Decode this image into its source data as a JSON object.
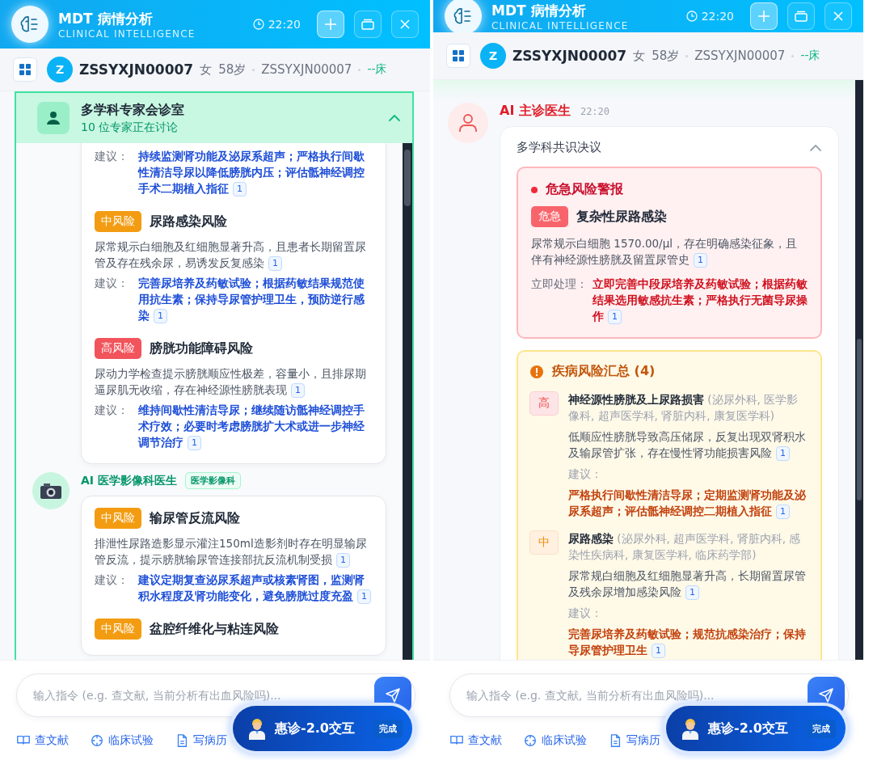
{
  "panels": [
    {
      "header": {
        "title": "MDT 病情分析",
        "subtitle": "CLINICAL INTELLIGENCE",
        "time": "22:20"
      },
      "patient": {
        "avatar": "Z",
        "id": "ZSSYXJN00007",
        "gender": "女",
        "age": "58岁",
        "record": "ZSSYXJN00007",
        "bed": "--床"
      },
      "kind": "room",
      "room": {
        "title": "多学科专家会诊室",
        "subtitle": "10 位专家正在讨论",
        "expanded": true
      },
      "messages": [
        {
          "items": [
            {
              "advice_label": "建议：",
              "advice": "持续监测肾功能及泌尿系超声；严格执行间歇性清洁导尿以降低膀胱内压；评估骶神经调控手术二期植入指征",
              "advice_ref": "1"
            },
            {
              "level": "中风险",
              "kind": "medium",
              "title": "尿路感染风险",
              "desc": "尿常规示白细胞及红细胞显著升高，且患者长期留置尿管及存在残余尿，易诱发反复感染",
              "desc_ref": "1",
              "advice_label": "建议：",
              "advice": "完善尿培养及药敏试验；根据药敏结果规范使用抗生素；保持导尿管护理卫生，预防逆行感染",
              "advice_ref": "1"
            },
            {
              "level": "高风险",
              "kind": "high",
              "title": "膀胱功能障碍风险",
              "desc": "尿动力学检查提示膀胱顺应性极差，容量小，且排尿期逼尿肌无收缩，存在神经源性膀胱表现",
              "desc_ref": "1",
              "advice_label": "建议：",
              "advice": "维持间歇性清洁导尿；继续随访骶神经调控手术疗效；必要时考虑膀胱扩大术或进一步神经调节治疗",
              "advice_ref": "1"
            }
          ]
        },
        {
          "sender": "AI 医学影像科医生",
          "tag": "医学影像科",
          "items": [
            {
              "level": "中风险",
              "kind": "medium",
              "title": "输尿管反流风险",
              "desc": "排泄性尿路造影显示灌注150ml造影剂时存在明显输尿管反流，提示膀胱输尿管连接部抗反流机制受损",
              "desc_ref": "1",
              "advice_label": "建议：",
              "advice": "建议定期复查泌尿系超声或核素肾图，监测肾积水程度及肾功能变化，避免膀胱过度充盈",
              "advice_ref": "1"
            },
            {
              "level": "中风险",
              "kind": "medium",
              "title": "盆腔纤维化与粘连风险"
            }
          ]
        }
      ],
      "input": {
        "placeholder": "输入指令 (e.g. 查文献, 当前分析有出血风险吗)..."
      },
      "tools": [
        "查文献",
        "临床试验",
        "写病历"
      ],
      "assistant": {
        "label": "惠诊-2.0交互",
        "status": "完成"
      }
    },
    {
      "header": {
        "title": "MDT 病情分析",
        "subtitle": "CLINICAL INTELLIGENCE",
        "time": "22:20"
      },
      "patient": {
        "avatar": "Z",
        "id": "ZSSYXJN00007",
        "gender": "女",
        "age": "58岁",
        "record": "ZSSYXJN00007",
        "bed": "--床"
      },
      "kind": "consensus",
      "consensus": {
        "sender": "AI 主诊医生",
        "time": "22:20",
        "title": "多学科共识决议",
        "expanded": true,
        "alert": {
          "title": "危急风险警报",
          "badge": "危急",
          "name": "复杂性尿路感染",
          "desc": "尿常规示白细胞 1570.00/μl，存在明确感染征象，且伴有神经源性膀胱及留置尿管史",
          "desc_ref": "1",
          "action_label": "立即处理：",
          "action": "立即完善中段尿培养及药敏试验；根据药敏结果选用敏感抗生素；严格执行无菌导尿操作",
          "action_ref": "1"
        },
        "summary": {
          "title": "疾病风险汇总 (4)",
          "items": [
            {
              "level": "高",
              "kind": "high",
              "name": "神经源性膀胱及上尿路损害",
              "departments": "(泌尿外科, 医学影像科, 超声医学科, 肾脏内科, 康复医学科)",
              "desc": "低顺应性膀胱导致高压储尿，反复出现双肾积水及输尿管扩张，存在慢性肾功能损害风险",
              "desc_ref": "1",
              "advice_label": "建议：",
              "advice": "严格执行间歇性清洁导尿；定期监测肾功能及泌尿系超声；评估骶神经调控二期植入指征",
              "advice_ref": "1"
            },
            {
              "level": "中",
              "kind": "medium",
              "name": "尿路感染",
              "departments": "(泌尿外科, 超声医学科, 肾脏内科, 感染性疾病科, 康复医学科, 临床药学部)",
              "desc": "尿常规白细胞及红细胞显著升高，长期留置尿管及残余尿增加感染风险",
              "desc_ref": "1",
              "advice_label": "建议：",
              "advice": "完善尿培养及药敏试验；规范抗感染治疗；保持导尿管护理卫生",
              "advice_ref": "1"
            }
          ]
        }
      },
      "input": {
        "placeholder": "输入指令 (e.g. 查文献, 当前分析有出血风险吗)..."
      },
      "tools": [
        "查文献",
        "临床试验",
        "写病历"
      ],
      "assistant": {
        "label": "惠诊-2.0交互",
        "status": "完成"
      }
    }
  ]
}
